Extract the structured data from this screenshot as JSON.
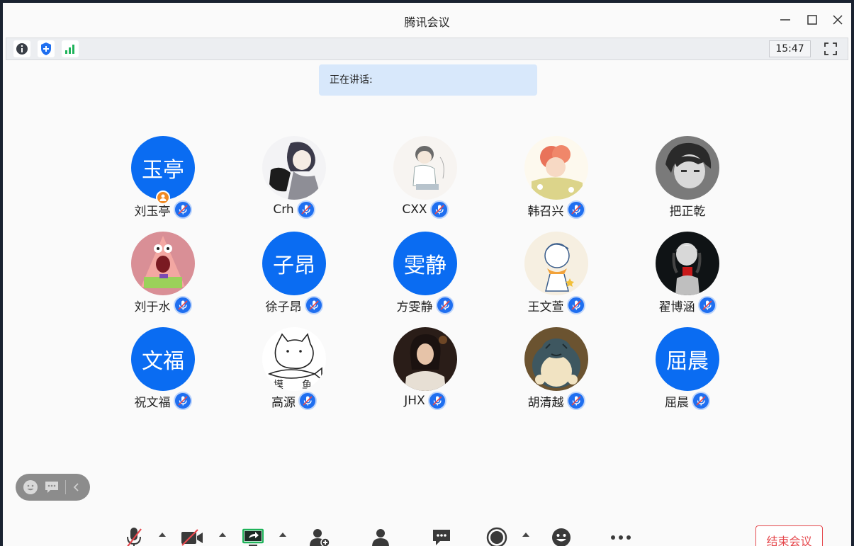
{
  "window": {
    "title": "腾讯会议"
  },
  "infobar": {
    "time": "15:47"
  },
  "speaking": {
    "label": "正在讲话:"
  },
  "participants": [
    {
      "name": "刘玉亭",
      "avatar_text": "玉亭",
      "type": "text",
      "host": true,
      "mic": true
    },
    {
      "name": "Crh",
      "type": "image",
      "mic": true
    },
    {
      "name": "CXX",
      "type": "image",
      "mic": true
    },
    {
      "name": "韩召兴",
      "type": "image",
      "mic": true
    },
    {
      "name": "把正乾",
      "type": "image",
      "mic": false
    },
    {
      "name": "刘于水",
      "type": "image",
      "mic": true
    },
    {
      "name": "徐子昂",
      "avatar_text": "子昂",
      "type": "text",
      "mic": true
    },
    {
      "name": "方雯静",
      "avatar_text": "雯静",
      "type": "text",
      "mic": true
    },
    {
      "name": "王文萱",
      "type": "image",
      "mic": true
    },
    {
      "name": "翟博涵",
      "type": "image",
      "mic": true
    },
    {
      "name": "祝文福",
      "avatar_text": "文福",
      "type": "text",
      "mic": true
    },
    {
      "name": "高源",
      "type": "image",
      "mic": true
    },
    {
      "name": "JHX",
      "type": "image",
      "mic": true
    },
    {
      "name": "胡清越",
      "type": "image",
      "mic": true
    },
    {
      "name": "屈晨",
      "avatar_text": "屈晨",
      "type": "text",
      "mic": true
    }
  ],
  "toolbar": {
    "end_label": "结束会议"
  },
  "colors": {
    "accent": "#0a6cf2",
    "end": "#e5484d",
    "host": "#f08a24"
  }
}
